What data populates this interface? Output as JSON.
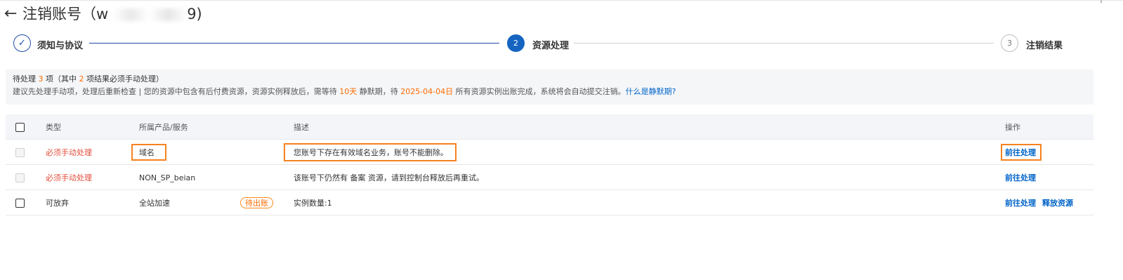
{
  "header": {
    "back_icon": "arrow-left-icon",
    "title": "注销账号（w",
    "title_end": "9)"
  },
  "steps": [
    {
      "index": "",
      "label": "须知与协议",
      "state": "done",
      "icon": "check-icon"
    },
    {
      "index": "2",
      "label": "资源处理",
      "state": "active"
    },
    {
      "index": "3",
      "label": "注销结果",
      "state": "wait"
    }
  ],
  "notice": {
    "line1": {
      "prefix": "待处理 ",
      "count": "3",
      "mid": " 项（其中 ",
      "must_count": "2",
      "suffix": " 项结果必须手动处理）"
    },
    "line2": {
      "part1": "建议先处理手动项，处理后重新检查 | 您的资源中包含有后付费资源，资源实例释放后，需等待 ",
      "days": "10天",
      "part2": " 静默期，待 ",
      "date": "2025-04-04日",
      "part3": " 所有资源实例出账完成，系统将会自动提交注销。",
      "link": "什么是静默期?"
    }
  },
  "table": {
    "headers": {
      "type": "类型",
      "product": "所属产品/服务",
      "desc": "描述",
      "action": "操作"
    },
    "rows": [
      {
        "type": "必须手动处理",
        "product": "域名",
        "desc": "您账号下存在有效域名业务，账号不能删除。",
        "actions": [
          "前往处理"
        ]
      },
      {
        "type": "必须手动处理",
        "product": "NON_SP_beian",
        "desc": "该账号下仍然有 备案 资源，请到控制台释放后再重试。",
        "actions": [
          "前往处理"
        ]
      },
      {
        "type": "可放弃",
        "product": "全站加速",
        "badge": "待出账",
        "desc": "实例数量:1",
        "actions": [
          "前往处理",
          "释放资源"
        ]
      }
    ]
  },
  "colors": {
    "accent": "#1565c0",
    "warning": "#ff6a00",
    "danger": "#e34d3c",
    "link": "#0064c8",
    "highlight": "#f5821f"
  }
}
